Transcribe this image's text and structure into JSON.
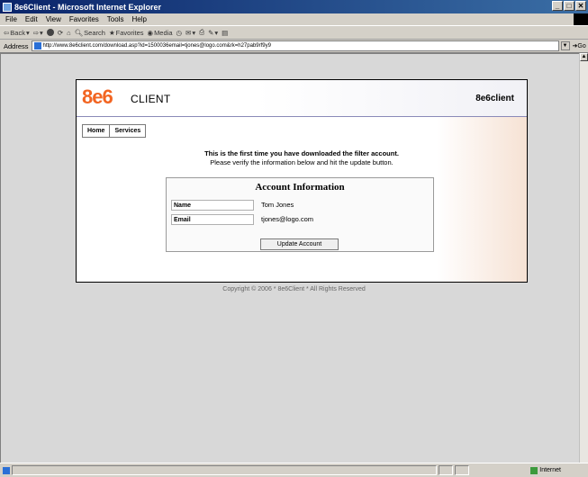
{
  "window": {
    "title": "8e6Client - Microsoft Internet Explorer"
  },
  "menu": [
    "File",
    "Edit",
    "View",
    "Favorites",
    "Tools",
    "Help"
  ],
  "toolbar": {
    "back": "Back",
    "search": "Search",
    "favorites": "Favorites",
    "media": "Media"
  },
  "address": {
    "label": "Address",
    "url": "http://www.8e6client.com/download.asp?id=1500036email=tjones@logo.com&rk=h27pab9rf9y9",
    "go": "Go"
  },
  "status": {
    "zone": "Internet"
  },
  "page": {
    "logo_mark": "8e6",
    "logo_sub": "CLIENT",
    "brand_right": "8e6client",
    "nav": [
      "Home",
      "Services"
    ],
    "message_primary": "This is the first time you have downloaded the filter account.",
    "message_secondary": "Please verify the information below and hit the update button.",
    "account": {
      "title": "Account Information",
      "name_label": "Name",
      "name_value": "Tom Jones",
      "email_label": "Email",
      "email_value": "tjones@logo.com",
      "update_button": "Update Account"
    },
    "copyright": "Copyright © 2006 * 8e6Client * All Rights Reserved"
  }
}
